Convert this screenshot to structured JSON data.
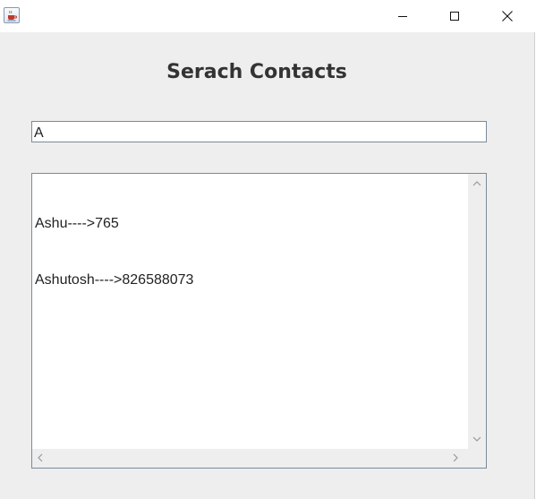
{
  "window": {
    "title": "",
    "icon": "java-cup-icon",
    "controls": [
      "minimize",
      "maximize",
      "close"
    ]
  },
  "main": {
    "heading": "Serach Contacts",
    "search": {
      "value": "A",
      "placeholder": ""
    },
    "results": [
      "Ashu---->765",
      "Ashutosh---->826588073"
    ]
  },
  "colors": {
    "background": "#eeeeee",
    "heading": "#333333",
    "border": "#7a8a99"
  }
}
